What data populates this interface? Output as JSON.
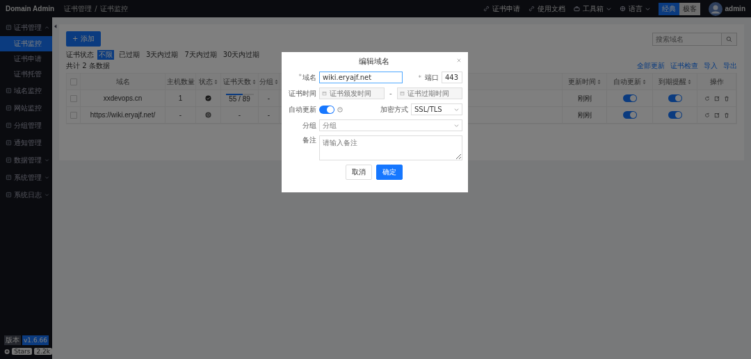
{
  "header": {
    "brand": "Domain Admin",
    "breadcrumb": [
      "证书管理",
      "证书监控"
    ],
    "breadcrumb_separator": "/",
    "links": [
      {
        "label": "证书申请",
        "kind": "link"
      },
      {
        "label": "使用文档",
        "kind": "link"
      },
      {
        "label": "工具箱",
        "kind": "tools"
      },
      {
        "label": "语言",
        "kind": "lang"
      }
    ],
    "theme_switch": [
      {
        "label": "经典",
        "selected": true
      },
      {
        "label": "极客",
        "selected": false
      }
    ],
    "user": "admin"
  },
  "sidebar": {
    "items": [
      {
        "label": "证书管理",
        "kind": "group",
        "expanded": true,
        "children": [
          {
            "label": "证书监控",
            "selected": true
          },
          {
            "label": "证书申请",
            "selected": false
          },
          {
            "label": "证书托管",
            "selected": false
          }
        ]
      },
      {
        "label": "域名监控",
        "kind": "link"
      },
      {
        "label": "网站监控",
        "kind": "link"
      },
      {
        "label": "分组管理",
        "kind": "link"
      },
      {
        "label": "通知管理",
        "kind": "link"
      },
      {
        "label": "数据管理",
        "kind": "group",
        "expanded": false
      },
      {
        "label": "系统管理",
        "kind": "group",
        "expanded": false
      },
      {
        "label": "系统日志",
        "kind": "group",
        "expanded": false
      }
    ],
    "version_label": "版本",
    "version": "v1.6.66",
    "stars_label": "Stars",
    "stars_count": "2.2k"
  },
  "toolbar": {
    "add_button": "+ 添加",
    "search": {
      "placeholder": "搜索域名"
    }
  },
  "status_filter": {
    "label": "证书状态",
    "options": [
      {
        "label": "不限",
        "selected": true
      },
      {
        "label": "已过期",
        "selected": false
      },
      {
        "label": "3天内过期",
        "selected": false
      },
      {
        "label": "7天内过期",
        "selected": false
      },
      {
        "label": "30天内过期",
        "selected": false
      }
    ]
  },
  "total": "共计 2 条数据",
  "actions": [
    "全部更新",
    "证书检查",
    "导入",
    "导出"
  ],
  "table": {
    "select_all": false,
    "columns": [
      "域名",
      "主机数量",
      "状态",
      "证书天数",
      "分组",
      "",
      "更新时间",
      "自动更新",
      "到期提醒",
      "操作"
    ],
    "rows": [
      {
        "checked": false,
        "domain": "xxdevops.cn",
        "hosts": "1",
        "status": {
          "kind": "ok"
        },
        "days": {
          "text": "55 / 89",
          "level": 0.62
        },
        "group": "-",
        "updated": "刚刚",
        "auto_update": true,
        "expiry_alert": true
      },
      {
        "checked": false,
        "domain": "https://wiki.eryajf.net/",
        "hosts": "-",
        "status": {
          "kind": "unknown"
        },
        "days": {
          "text": "-"
        },
        "group": "-",
        "updated": "刚刚",
        "auto_update": true,
        "expiry_alert": true
      }
    ]
  },
  "dialog": {
    "title": "编辑域名",
    "required_mark": "*",
    "domain_label": "域名",
    "domain_value": "wiki.eryajf.net",
    "port_label": "端口",
    "port_value": "443",
    "cert_time_label": "证书时间",
    "start_placeholder": "证书颁发时间",
    "separator": "-",
    "end_placeholder": "证书过期时间",
    "auto_update_label": "自动更新",
    "auto_update": true,
    "encryption_label": "加密方式",
    "encryption_value": "SSL/TLS",
    "group_label": "分组",
    "group_placeholder": "分组",
    "note_label": "备注",
    "note_placeholder": "请输入备注",
    "buttons": [
      {
        "label": "取消",
        "kind": "default"
      },
      {
        "label": "确定",
        "kind": "primary"
      }
    ]
  }
}
